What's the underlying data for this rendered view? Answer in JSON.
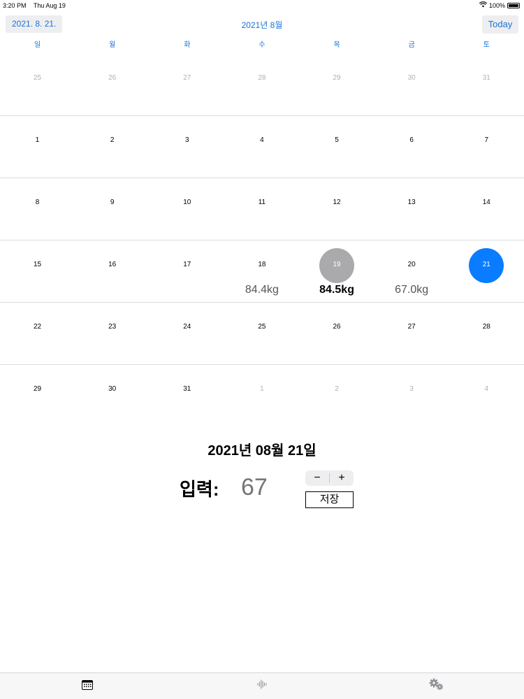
{
  "status_bar": {
    "time": "3:20 PM",
    "date": "Thu Aug 19",
    "battery": "100%"
  },
  "header": {
    "selected_date_button": "2021. 8. 21.",
    "month_title": "2021년 8월",
    "today_button": "Today"
  },
  "weekdays": [
    "일",
    "월",
    "화",
    "수",
    "목",
    "금",
    "토"
  ],
  "weeks": [
    [
      {
        "d": "25",
        "out": true
      },
      {
        "d": "26",
        "out": true
      },
      {
        "d": "27",
        "out": true
      },
      {
        "d": "28",
        "out": true
      },
      {
        "d": "29",
        "out": true
      },
      {
        "d": "30",
        "out": true
      },
      {
        "d": "31",
        "out": true
      }
    ],
    [
      {
        "d": "1"
      },
      {
        "d": "2"
      },
      {
        "d": "3"
      },
      {
        "d": "4"
      },
      {
        "d": "5"
      },
      {
        "d": "6"
      },
      {
        "d": "7"
      }
    ],
    [
      {
        "d": "8"
      },
      {
        "d": "9"
      },
      {
        "d": "10"
      },
      {
        "d": "11"
      },
      {
        "d": "12"
      },
      {
        "d": "13"
      },
      {
        "d": "14"
      }
    ],
    [
      {
        "d": "15"
      },
      {
        "d": "16"
      },
      {
        "d": "17"
      },
      {
        "d": "18",
        "weight": "84.4kg"
      },
      {
        "d": "19",
        "weight": "84.5kg",
        "sel": "gray",
        "bold": true
      },
      {
        "d": "20",
        "weight": "67.0kg"
      },
      {
        "d": "21",
        "sel": "blue"
      }
    ],
    [
      {
        "d": "22"
      },
      {
        "d": "23"
      },
      {
        "d": "24"
      },
      {
        "d": "25"
      },
      {
        "d": "26"
      },
      {
        "d": "27"
      },
      {
        "d": "28"
      }
    ],
    [
      {
        "d": "29"
      },
      {
        "d": "30"
      },
      {
        "d": "31"
      },
      {
        "d": "1",
        "out": true
      },
      {
        "d": "2",
        "out": true
      },
      {
        "d": "3",
        "out": true
      },
      {
        "d": "4",
        "out": true
      }
    ]
  ],
  "entry": {
    "selected_date": "2021년 08월 21일",
    "input_label": "입력:",
    "input_placeholder": "67",
    "stepper_minus": "−",
    "stepper_plus": "+",
    "save_label": "저장"
  },
  "tabs": [
    {
      "name": "tab-calendar",
      "icon": "calendar-icon"
    },
    {
      "name": "tab-chart",
      "icon": "waveform-icon"
    },
    {
      "name": "tab-settings",
      "icon": "gears-icon"
    }
  ],
  "colors": {
    "accent": "#0a7cff",
    "link": "#1a73d9",
    "selected_gray": "#aaaaac"
  }
}
